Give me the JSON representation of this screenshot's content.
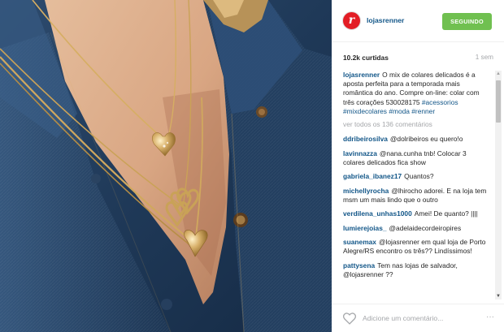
{
  "post": {
    "image_alt": "Colares dourados sobre camisa jeans"
  },
  "header": {
    "avatar_letter": "r",
    "username": "lojasrenner",
    "follow_label": "SEGUINDO"
  },
  "stats": {
    "likes": "10.2k curtidas",
    "time_ago": "1 sem"
  },
  "caption": {
    "username": "lojasrenner",
    "text": "O mix de colares delicados é a aposta perfeita para a temporada mais romântica do ano. Compre on-line: colar com três corações 530028175",
    "hashtags": "#acessorios #mixdecolares #moda #renner"
  },
  "view_all_comments": "ver todos os 136 comentários",
  "comments": [
    {
      "username": "ddribeirosilva",
      "text": "@dolribeiros eu quero!o"
    },
    {
      "username": "lavinnazza",
      "text": "@nana.cunha tnb! Colocar 3 colares delicados fica show"
    },
    {
      "username": "gabriela_ibanez17",
      "text": "Quantos?"
    },
    {
      "username": "michellyrocha",
      "text": "@lhirocho adorei. E na loja tem msm um mais lindo que o outro"
    },
    {
      "username": "verdilena_unhas1000",
      "text": "Amei! De quanto? ||||"
    },
    {
      "username": "lumierejoias_",
      "text": "@adelaidecordeiropires"
    },
    {
      "username": "suanemax",
      "text": "@lojasrenner em qual loja de Porto Alegre/RS encontro os três?? Lindíssimos!"
    },
    {
      "username": "pattysena",
      "text": "Tem nas lojas de salvador, @lojasrenner ??"
    }
  ],
  "footer": {
    "comment_placeholder": "Adicione um comentário...",
    "more_label": "···"
  },
  "colors": {
    "link": "#125688",
    "follow_green": "#70c050",
    "brand_red": "#e31d25",
    "muted": "#a5a7aa"
  },
  "icons": [
    "heart-icon",
    "more-options-icon",
    "scroll-up-arrow-icon",
    "scroll-down-arrow-icon"
  ]
}
